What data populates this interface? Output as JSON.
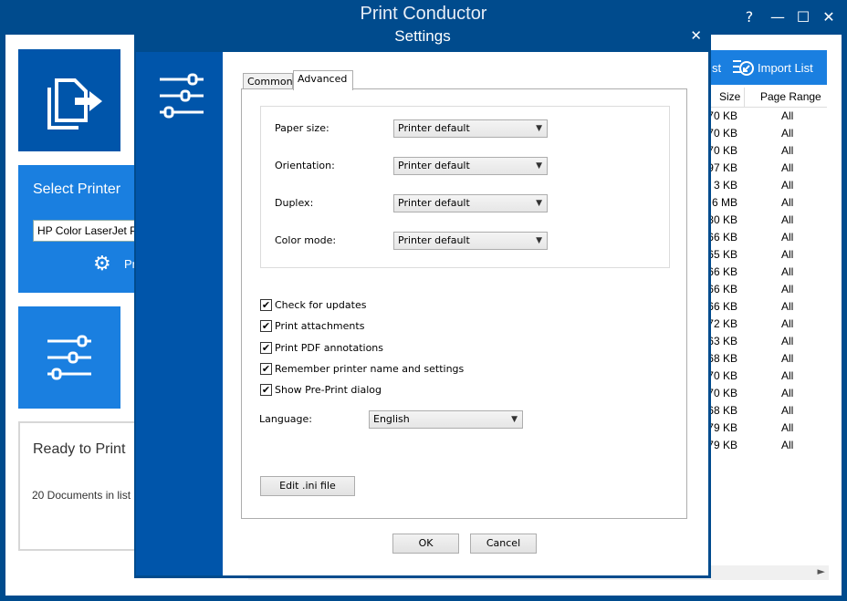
{
  "app": {
    "title": "Print Conductor",
    "help_glyph": "?",
    "minimize_glyph": "—",
    "maximize_glyph": "☐",
    "close_glyph": "✕"
  },
  "main": {
    "select_printer_label": "Select Printer",
    "printer_value": "HP Color LaserJet Pr",
    "printer_settings_label": "Pr",
    "status_title": "Ready to Print",
    "status_detail": "20 Documents in list",
    "save_list_partial": "st",
    "import_list_label": "Import List",
    "columns": {
      "size": "Size",
      "page_range": "Page Range"
    },
    "rows": [
      {
        "size": "70 KB",
        "range": "All"
      },
      {
        "size": "70 KB",
        "range": "All"
      },
      {
        "size": "70 KB",
        "range": "All"
      },
      {
        "size": "97 KB",
        "range": "All"
      },
      {
        "size": "3 KB",
        "range": "All"
      },
      {
        "size": "6 MB",
        "range": "All"
      },
      {
        "size": "80 KB",
        "range": "All"
      },
      {
        "size": "66 KB",
        "range": "All"
      },
      {
        "size": "65 KB",
        "range": "All"
      },
      {
        "size": "66 KB",
        "range": "All"
      },
      {
        "size": "66 KB",
        "range": "All"
      },
      {
        "size": "66 KB",
        "range": "All"
      },
      {
        "size": "72 KB",
        "range": "All"
      },
      {
        "size": "63 KB",
        "range": "All"
      },
      {
        "size": "68 KB",
        "range": "All"
      },
      {
        "size": "70 KB",
        "range": "All"
      },
      {
        "size": "70 KB",
        "range": "All"
      },
      {
        "size": "68 KB",
        "range": "All"
      },
      {
        "size": "79 KB",
        "range": "All"
      },
      {
        "size": "79 KB",
        "range": "All"
      }
    ]
  },
  "dialog": {
    "title": "Settings",
    "close_glyph": "✕",
    "tabs": [
      {
        "label": "Common"
      },
      {
        "label": "Advanced"
      }
    ],
    "fields": {
      "paper_size": {
        "label": "Paper size:",
        "value": "Printer default"
      },
      "orientation": {
        "label": "Orientation:",
        "value": "Printer default"
      },
      "duplex": {
        "label": "Duplex:",
        "value": "Printer default"
      },
      "color_mode": {
        "label": "Color mode:",
        "value": "Printer default"
      }
    },
    "checkboxes": [
      {
        "label": "Check for updates",
        "checked": "✔"
      },
      {
        "label": "Print attachments",
        "checked": "✔"
      },
      {
        "label": "Print PDF annotations",
        "checked": "✔"
      },
      {
        "label": "Remember printer name and settings",
        "checked": "✔"
      },
      {
        "label": "Show Pre-Print dialog",
        "checked": "✔"
      }
    ],
    "language": {
      "label": "Language:",
      "value": "English"
    },
    "edit_ini_label": "Edit .ini file",
    "ok_label": "OK",
    "cancel_label": "Cancel",
    "caret_glyph": "▼"
  }
}
